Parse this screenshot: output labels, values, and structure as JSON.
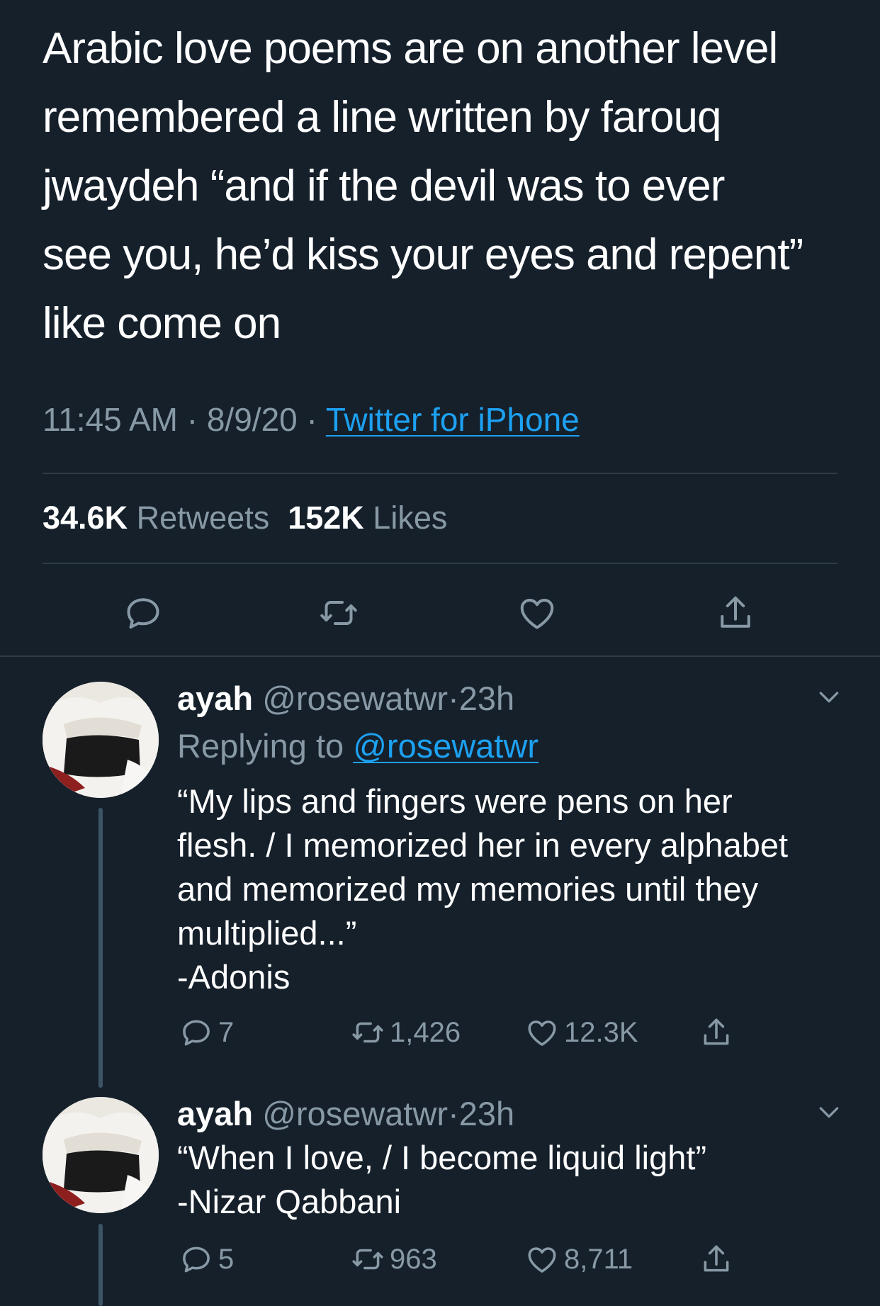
{
  "tweet": {
    "text": "Arabic love poems are on another level\nremembered a line written by farouq\njwaydeh “and if the devil was to ever\nsee you, he’d kiss your eyes and repent”\nlike come on",
    "time": "11:45 AM",
    "date": "8/9/20",
    "separator": "·",
    "source": "Twitter for iPhone",
    "retweets_count": "34.6K",
    "retweets_label": "Retweets",
    "likes_count": "152K",
    "likes_label": "Likes",
    "actions": [
      "reply-icon",
      "retweet-icon",
      "like-icon",
      "share-icon"
    ]
  },
  "replies": [
    {
      "name": "ayah",
      "handle": "@rosewatwr",
      "separator": "·",
      "time": "23h",
      "replying_prefix": "Replying to",
      "replying_to": "@rosewatwr",
      "text": "“My lips and fingers were pens on her\nflesh. /  I memorized her in every alphabet\nand memorized my memories until they\nmultiplied...”\n-Adonis",
      "replies_count": "7",
      "retweets_count": "1,426",
      "likes_count": "12.3K"
    },
    {
      "name": "ayah",
      "handle": "@rosewatwr",
      "separator": "·",
      "time": "23h",
      "text": "“When I love, / I become liquid light”\n-Nizar Qabbani",
      "replies_count": "5",
      "retweets_count": "963",
      "likes_count": "8,711"
    }
  ],
  "colors": {
    "background": "#15202b",
    "text": "#ffffff",
    "secondary": "#8899a6",
    "link": "#1da1f2",
    "divider": "#2f3b47"
  }
}
